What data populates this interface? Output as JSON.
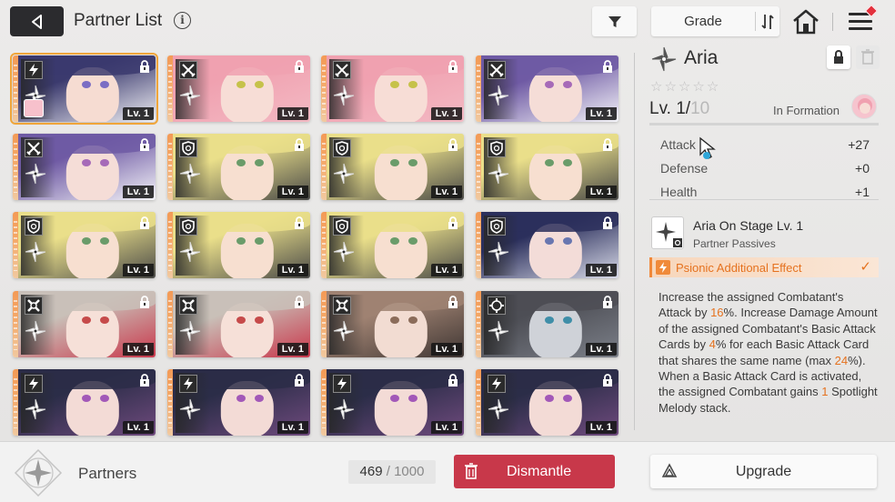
{
  "header": {
    "title": "Partner List",
    "info_icon": "i",
    "sort": {
      "label": "Grade"
    }
  },
  "cards": [
    {
      "name": "Aria",
      "level": "Lv. 1",
      "type": "bolt",
      "hair": "#3b3a6e",
      "skin": "#f6dcd2",
      "accent": "#f0f0f4",
      "eyes": "#7b6dc4",
      "selected": true,
      "mini_avatar": true
    },
    {
      "name": "pink",
      "level": "Lv. 1",
      "type": "swords",
      "hair": "#f0a1b0",
      "skin": "#f7ddd6",
      "accent": "#f3b9c3",
      "eyes": "#c6c24a"
    },
    {
      "name": "pink",
      "level": "Lv. 1",
      "type": "swords",
      "hair": "#f0a1b0",
      "skin": "#f7ddd6",
      "accent": "#f3b9c3",
      "eyes": "#c6c24a"
    },
    {
      "name": "purple-hat",
      "level": "Lv. 1",
      "type": "swords",
      "hair": "#6f5aa4",
      "skin": "#f5ddd7",
      "accent": "#f4f4f8",
      "eyes": "#a66ab8"
    },
    {
      "name": "purple-hat",
      "level": "Lv. 1",
      "type": "swords",
      "hair": "#6f5aa4",
      "skin": "#f5ddd7",
      "accent": "#f4f4f8",
      "eyes": "#a66ab8"
    },
    {
      "name": "blonde",
      "level": "Lv. 1",
      "type": "shield",
      "hair": "#eadf8a",
      "skin": "#f7dfd0",
      "accent": "#4a4a48",
      "eyes": "#6a9c6a"
    },
    {
      "name": "blonde",
      "level": "Lv. 1",
      "type": "shield",
      "hair": "#eadf8a",
      "skin": "#f7dfd0",
      "accent": "#4a4a48",
      "eyes": "#6a9c6a"
    },
    {
      "name": "blonde",
      "level": "Lv. 1",
      "type": "shield",
      "hair": "#eadf8a",
      "skin": "#f7dfd0",
      "accent": "#4a4a48",
      "eyes": "#6a9c6a"
    },
    {
      "name": "blonde",
      "level": "Lv. 1",
      "type": "shield",
      "hair": "#eadf8a",
      "skin": "#f7dfd0",
      "accent": "#4a4a48",
      "eyes": "#6a9c6a"
    },
    {
      "name": "blonde",
      "level": "Lv. 1",
      "type": "shield",
      "hair": "#eadf8a",
      "skin": "#f7dfd0",
      "accent": "#4a4a48",
      "eyes": "#6a9c6a"
    },
    {
      "name": "blonde",
      "level": "Lv. 1",
      "type": "shield",
      "hair": "#eadf8a",
      "skin": "#f7dfd0",
      "accent": "#4a4a48",
      "eyes": "#6a9c6a"
    },
    {
      "name": "navy",
      "level": "Lv. 1",
      "type": "shield",
      "hair": "#2b2f5c",
      "skin": "#f3dcd8",
      "accent": "#d9dbe8",
      "eyes": "#6876b0"
    },
    {
      "name": "silver",
      "level": "Lv. 1",
      "type": "cross",
      "hair": "#c9c0b8",
      "skin": "#f6e0d8",
      "accent": "#c9374b",
      "eyes": "#c64a4a"
    },
    {
      "name": "silver",
      "level": "Lv. 1",
      "type": "cross",
      "hair": "#c9c0b8",
      "skin": "#f6e0d8",
      "accent": "#c9374b",
      "eyes": "#c64a4a"
    },
    {
      "name": "brown",
      "level": "Lv. 1",
      "type": "cross",
      "hair": "#9f8272",
      "skin": "#f2dcd2",
      "accent": "#3f3633",
      "eyes": "#8b6c5a"
    },
    {
      "name": "armored",
      "level": "Lv. 1",
      "type": "gear",
      "hair": "#4d4e55",
      "skin": "#cfd2d8",
      "accent": "#7b7f88",
      "eyes": "#3f8ea8"
    },
    {
      "name": "glasses",
      "level": "Lv. 1",
      "type": "bolt",
      "hair": "#2b2d48",
      "skin": "#f3dbd6",
      "accent": "#6f4a7d",
      "eyes": "#a258b8"
    },
    {
      "name": "glasses",
      "level": "Lv. 1",
      "type": "bolt",
      "hair": "#2b2d48",
      "skin": "#f3dbd6",
      "accent": "#6f4a7d",
      "eyes": "#a258b8"
    },
    {
      "name": "glasses",
      "level": "Lv. 1",
      "type": "bolt",
      "hair": "#2b2d48",
      "skin": "#f3dbd6",
      "accent": "#6f4a7d",
      "eyes": "#a258b8"
    },
    {
      "name": "glasses",
      "level": "Lv. 1",
      "type": "bolt",
      "hair": "#2b2d48",
      "skin": "#f3dbd6",
      "accent": "#6f4a7d",
      "eyes": "#a258b8"
    }
  ],
  "detail": {
    "name": "Aria",
    "stars": [
      "☆",
      "☆",
      "☆",
      "☆",
      "☆"
    ],
    "level_label": "Lv. 1/",
    "level_max": "10",
    "formation": "In Formation",
    "stats": [
      {
        "label": "Attack",
        "value": "+27"
      },
      {
        "label": "Defense",
        "value": "+0"
      },
      {
        "label": "Health",
        "value": "+1"
      }
    ],
    "passive": {
      "name": "Aria On Stage Lv. 1",
      "type": "Partner Passives",
      "effect": "Psionic Additional Effect",
      "description_parts": [
        {
          "t": "Increase the assigned Combatant's Attack by "
        },
        {
          "t": "16",
          "hl": true
        },
        {
          "t": "%. Increase Damage Amount of the assigned Combatant's Basic Attack Cards by "
        },
        {
          "t": "4",
          "hl": true
        },
        {
          "t": "% for each Basic Attack Card that shares the same name (max "
        },
        {
          "t": "24",
          "hl": true
        },
        {
          "t": "%). When a Basic Attack Card is activated, the assigned Combatant gains "
        },
        {
          "t": "1",
          "hl": true
        },
        {
          "t": " Spotlight Melody stack."
        }
      ]
    }
  },
  "footer": {
    "partners_label": "Partners",
    "count": "469",
    "count_total": "/ 1000",
    "dismantle": "Dismantle",
    "upgrade": "Upgrade"
  },
  "colors": {
    "accent_orange": "#e5721f",
    "dismantle_red": "#c8384a",
    "selected_border": "#f0a53a"
  }
}
